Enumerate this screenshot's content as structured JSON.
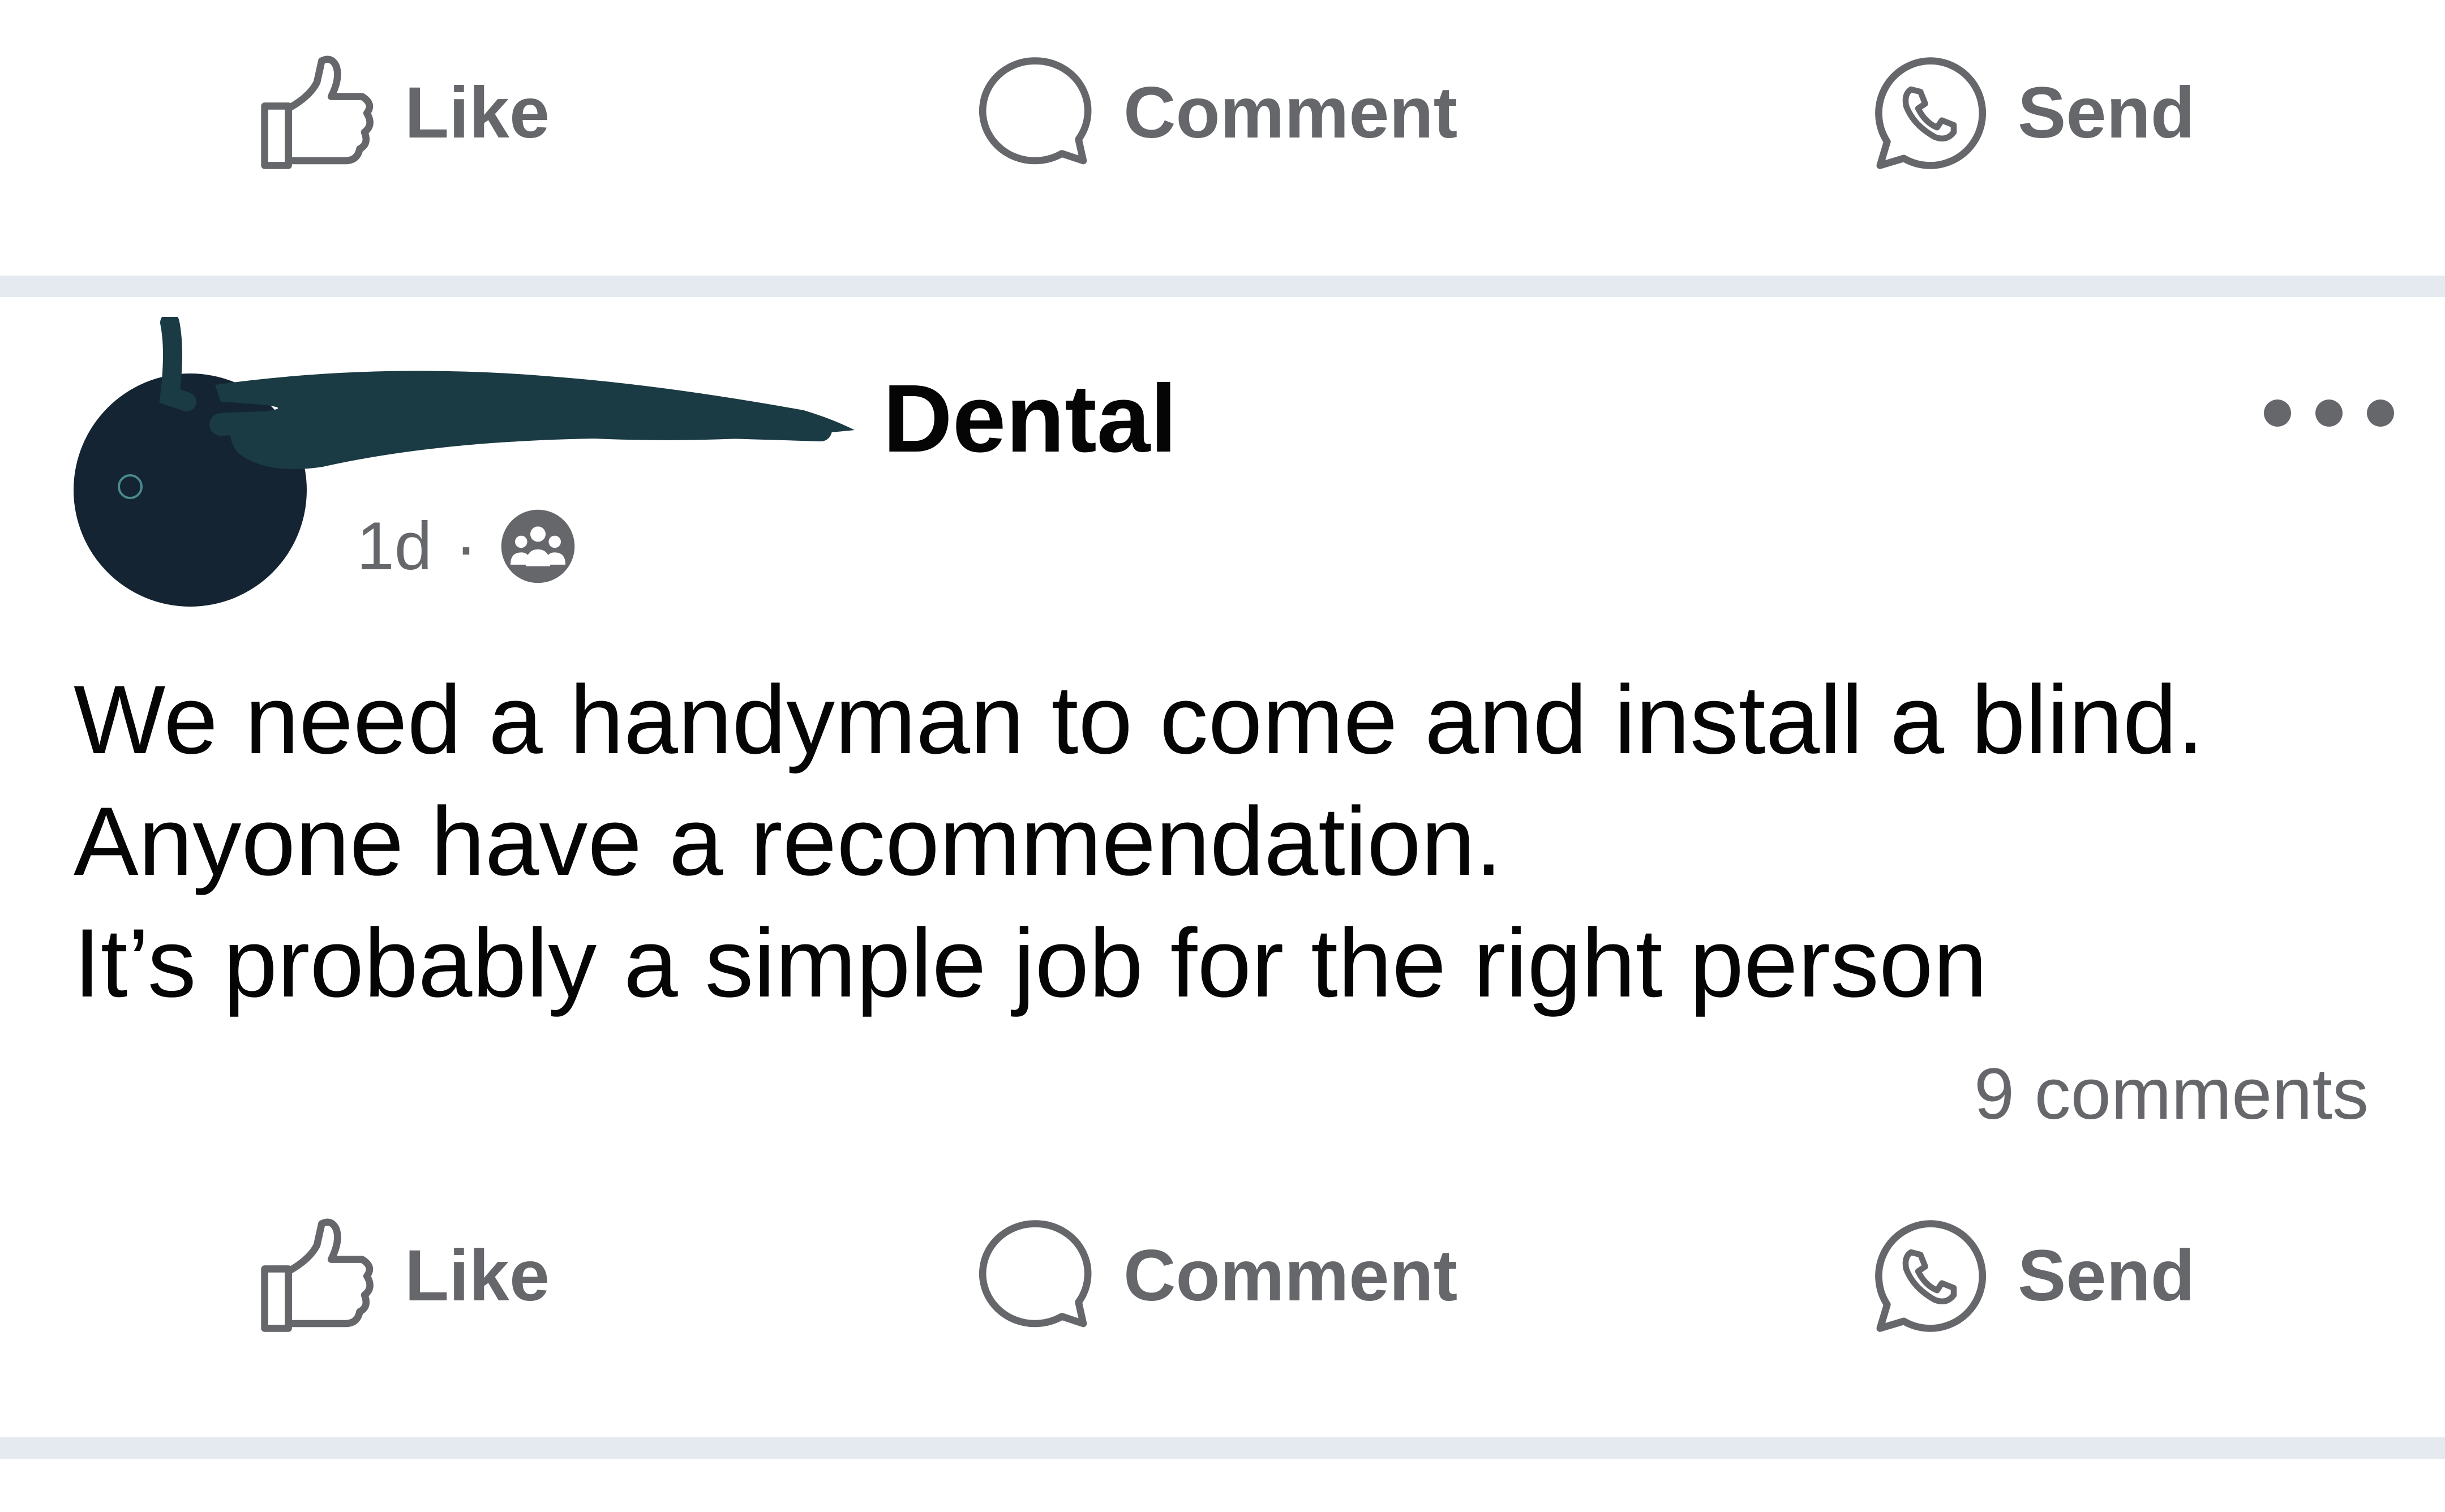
{
  "top_actions": {
    "like": "Like",
    "comment": "Comment",
    "send": "Send"
  },
  "post": {
    "author_suffix": "Dental",
    "time": "1d",
    "separator": "·",
    "audience_icon": "group-icon",
    "body_lines": [
      "We need a handyman to come and install a blind.",
      "Anyone have a recommendation.",
      "It’s probably a simple job for the right person"
    ],
    "comment_count": "9 comments"
  },
  "bottom_actions": {
    "like": "Like",
    "comment": "Comment",
    "send": "Send"
  },
  "icons": {
    "like": "thumbs-up-icon",
    "comment": "speech-bubble-icon",
    "send": "whatsapp-icon",
    "more": "more-dots-icon"
  },
  "colors": {
    "icon_gray": "#65676b",
    "text": "#050505",
    "divider": "#e4eaf0",
    "avatar": "#142433",
    "redaction": "#1a3a44"
  }
}
